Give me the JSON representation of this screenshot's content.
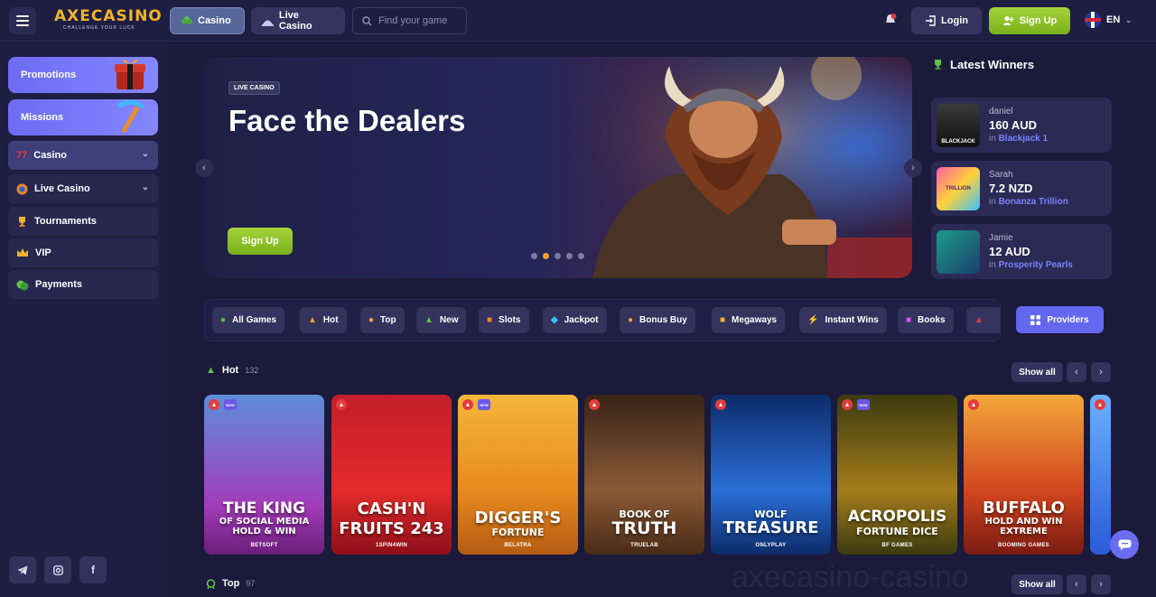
{
  "header": {
    "logo_text": "AXECASINO",
    "logo_tagline": "CHALLENGE YOUR LUCK",
    "nav": [
      {
        "label": "Casino"
      },
      {
        "label": "Live Casino"
      }
    ],
    "search_placeholder": "Find your game",
    "login_label": "Login",
    "signup_label": "Sign Up",
    "language": "EN"
  },
  "sidebar": {
    "promotions_label": "Promotions",
    "missions_label": "Missions",
    "items": [
      {
        "label": "Casino",
        "icon": "slot-777-icon",
        "expandable": true
      },
      {
        "label": "Live Casino",
        "icon": "casino-chip-icon",
        "expandable": true
      },
      {
        "label": "Tournaments",
        "icon": "trophy-icon",
        "expandable": false
      },
      {
        "label": "VIP",
        "icon": "crown-icon",
        "expandable": false
      },
      {
        "label": "Payments",
        "icon": "money-icon",
        "expandable": false
      }
    ],
    "social": [
      "telegram-icon",
      "instagram-icon",
      "facebook-icon"
    ]
  },
  "hero": {
    "tag": "LIVE CASINO",
    "title": "Face the Dealers",
    "button_label": "Sign Up",
    "slides": 5,
    "active_slide": 2
  },
  "winners": {
    "title": "Latest Winners",
    "list": [
      {
        "name": "daniel",
        "amount": "160 AUD",
        "prefix": "in",
        "game": "Blackjack 1"
      },
      {
        "name": "Sarah",
        "amount": "7.2 NZD",
        "prefix": "in",
        "game": "Bonanza Trillion"
      },
      {
        "name": "Jamie",
        "amount": "12 AUD",
        "prefix": "in",
        "game": "Prosperity Pearls"
      }
    ]
  },
  "categories": [
    {
      "label": "All Games",
      "icon": "all-games-icon"
    },
    {
      "label": "Hot",
      "icon": "fire-icon"
    },
    {
      "label": "Top",
      "icon": "medal-icon"
    },
    {
      "label": "New",
      "icon": "new-icon"
    },
    {
      "label": "Slots",
      "icon": "slots-icon"
    },
    {
      "label": "Jackpot",
      "icon": "diamond-icon"
    },
    {
      "label": "Bonus Buy",
      "icon": "bonus-icon"
    },
    {
      "label": "Megaways",
      "icon": "megaways-icon"
    },
    {
      "label": "Instant Wins",
      "icon": "lightning-icon"
    },
    {
      "label": "Books",
      "icon": "book-icon"
    },
    {
      "label": "",
      "icon": "watermelon-icon"
    }
  ],
  "providers_label": "Providers",
  "hot_section": {
    "title": "Hot",
    "count": "132",
    "show_all": "Show all",
    "games": [
      {
        "title1": "THE KING",
        "title2": "OF SOCIAL MEDIA",
        "title3": "HOLD & WIN",
        "provider": "BETSOFT",
        "new": true
      },
      {
        "title1": "CASH'N",
        "title2": "FRUITS 243",
        "title3": "",
        "provider": "1SPIN4WIN",
        "new": false
      },
      {
        "title1": "DIGGER'S",
        "title2": "FORTUNE",
        "title3": "",
        "provider": "BELATRA",
        "new": true
      },
      {
        "title1": "BOOK OF",
        "title2": "TRUTH",
        "title3": "",
        "provider": "TRUELAB",
        "new": false
      },
      {
        "title1": "WOLF",
        "title2": "TREASURE",
        "title3": "",
        "provider": "ONLYPLAY",
        "new": false
      },
      {
        "title1": "ACROPOLIS",
        "title2": "FORTUNE DICE",
        "title3": "",
        "provider": "BF GAMES",
        "new": true
      },
      {
        "title1": "BUFFALO",
        "title2": "HOLD AND WIN",
        "title3": "EXTREME",
        "provider": "BOOMING GAMES",
        "new": false
      }
    ]
  },
  "top_section": {
    "title": "Top",
    "count": "97",
    "show_all": "Show all"
  },
  "new_badge": "NEW",
  "watermark": "axecasino-casino"
}
